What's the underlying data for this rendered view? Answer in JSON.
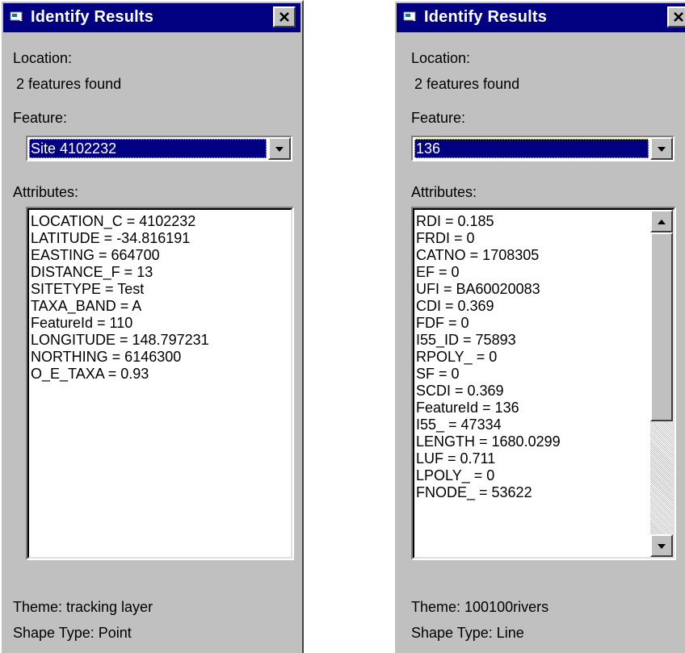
{
  "windows": [
    {
      "title": "Identify Results",
      "location_label": "Location:",
      "features_found": "2 features found",
      "feature_label": "Feature:",
      "feature_selected": "Site 4102232",
      "attributes_label": "Attributes:",
      "attributes": [
        "LOCATION_C = 4102232",
        "LATITUDE = -34.816191",
        "EASTING = 664700",
        "DISTANCE_F = 13",
        "SITETYPE = Test",
        "TAXA_BAND = A",
        "FeatureId = 110",
        "LONGITUDE = 148.797231",
        "NORTHING = 6146300",
        "O_E_TAXA = 0.93"
      ],
      "theme": "Theme:  tracking layer",
      "shape_type": "Shape Type:  Point"
    },
    {
      "title": "Identify Results",
      "location_label": "Location:",
      "features_found": "2 features found",
      "feature_label": "Feature:",
      "feature_selected": "136",
      "attributes_label": "Attributes:",
      "attributes": [
        "RDI = 0.185",
        "FRDI = 0",
        "CATNO = 1708305",
        "EF = 0",
        "UFI = BA60020083",
        "CDI = 0.369",
        "FDF = 0",
        "I55_ID = 75893",
        "RPOLY_ = 0",
        "SF = 0",
        "SCDI = 0.369",
        "FeatureId = 136",
        "I55_ = 47334",
        "LENGTH = 1680.0299",
        "LUF = 0.711",
        "LPOLY_ = 0",
        "FNODE_ = 53622"
      ],
      "theme": "Theme:  100100rivers",
      "shape_type": "Shape Type:  Line"
    }
  ],
  "icons": {
    "title": "window-icon",
    "close": "close-icon",
    "dropdown": "chevron-down-icon",
    "scroll_up": "scroll-up-icon",
    "scroll_down": "scroll-down-icon"
  },
  "colors": {
    "titlebar": "#000080",
    "window_bg": "#c0c0c0",
    "selection": "#000080"
  }
}
